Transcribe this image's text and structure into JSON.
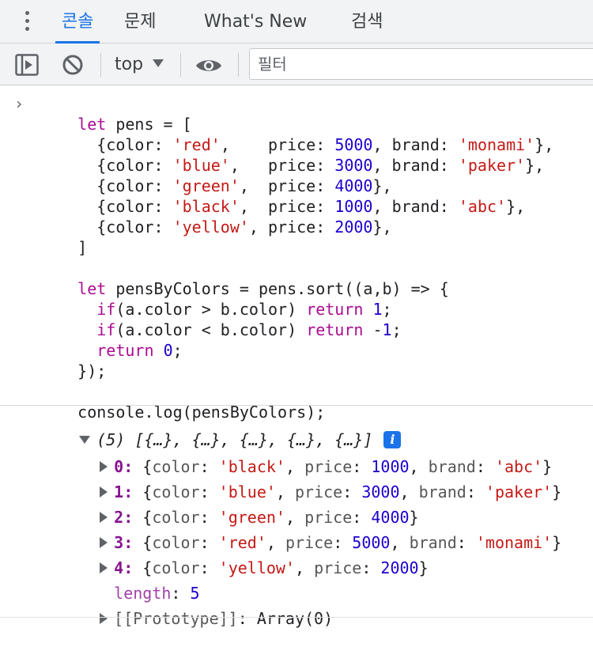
{
  "tabs": [
    {
      "label": "콘솔",
      "active": true
    },
    {
      "label": "문제",
      "active": false
    },
    {
      "label": "What's New",
      "active": false
    },
    {
      "label": "검색",
      "active": false
    }
  ],
  "toolbar": {
    "context": "top",
    "filter_placeholder": "필터"
  },
  "code": {
    "l1": [
      "let",
      " pens = ["
    ],
    "l2": [
      "  {color: ",
      "'red'",
      ",    price: ",
      "5000",
      ", brand: ",
      "'monami'",
      "},"
    ],
    "l3": [
      "  {color: ",
      "'blue'",
      ",   price: ",
      "3000",
      ", brand: ",
      "'paker'",
      "},"
    ],
    "l4": [
      "  {color: ",
      "'green'",
      ",  price: ",
      "4000",
      "},"
    ],
    "l5": [
      "  {color: ",
      "'black'",
      ",  price: ",
      "1000",
      ", brand: ",
      "'abc'",
      "},"
    ],
    "l6": [
      "  {color: ",
      "'yellow'",
      ", price: ",
      "2000",
      "},"
    ],
    "l7": "]",
    "l9": [
      "let",
      " pensByColors = pens.sort((a,b) => {"
    ],
    "l10": [
      "  ",
      "if",
      "(a.color > b.color) ",
      "return",
      " ",
      "1",
      ";"
    ],
    "l11": [
      "  ",
      "if",
      "(a.color < b.color) ",
      "return",
      " -",
      "1",
      ";"
    ],
    "l12": [
      "  ",
      "return",
      " ",
      "0",
      ";"
    ],
    "l13": "});",
    "l15": "console.log(pensByColors);"
  },
  "result": {
    "summary_count": "(5)",
    "summary_preview": "[{…}, {…}, {…}, {…}, {…}]",
    "items": [
      {
        "index": "0",
        "color": "'black'",
        "price": "1000",
        "brand": "'abc'"
      },
      {
        "index": "1",
        "color": "'blue'",
        "price": "3000",
        "brand": "'paker'"
      },
      {
        "index": "2",
        "color": "'green'",
        "price": "4000",
        "brand": ""
      },
      {
        "index": "3",
        "color": "'red'",
        "price": "5000",
        "brand": "'monami'"
      },
      {
        "index": "4",
        "color": "'yellow'",
        "price": "2000",
        "brand": ""
      }
    ],
    "length_key": "length",
    "length_value": "5",
    "prototype_key": "[[Prototype]]",
    "prototype_value": "Array(0)"
  },
  "colors": {
    "keyword": "#aa0d91",
    "string": "#c41a16",
    "number": "#1c00cf",
    "accent": "#1a73e8"
  }
}
